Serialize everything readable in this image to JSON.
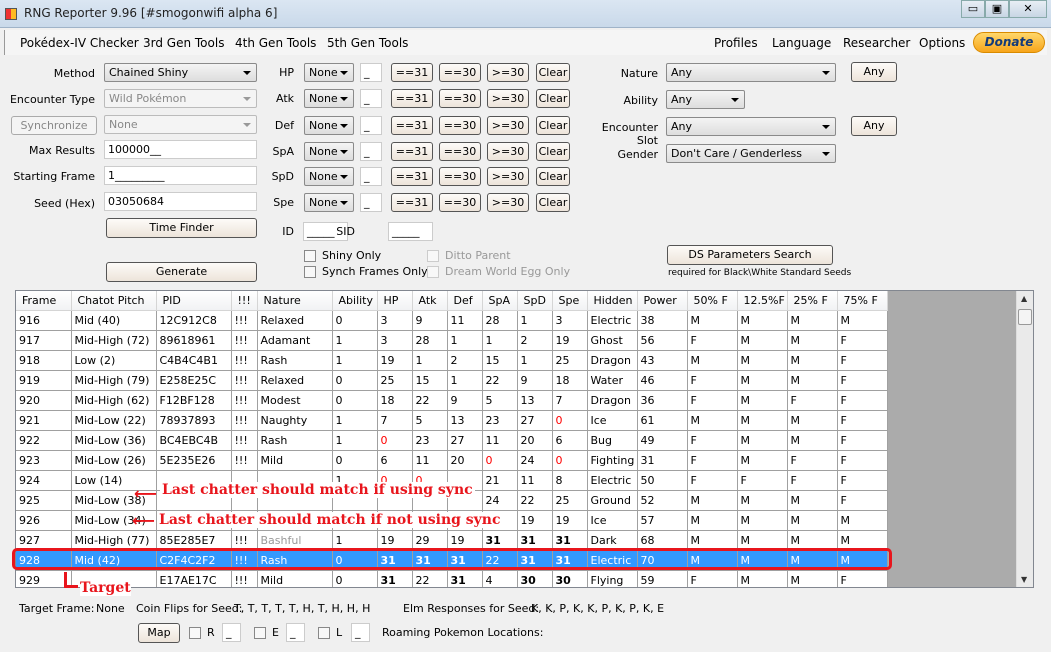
{
  "window": {
    "title": "RNG Reporter 9.96 [#smogonwifi alpha 6]",
    "controls": [
      "minimize",
      "maximize",
      "close"
    ]
  },
  "menu": {
    "left": [
      "Pokédex-IV Checker",
      "3rd Gen Tools",
      "4th Gen Tools",
      "5th Gen Tools"
    ],
    "right": [
      "Profiles",
      "Language",
      "Researcher",
      "Options"
    ],
    "donate": "Donate"
  },
  "form": {
    "method_label": "Method",
    "method": "Chained Shiny",
    "encounter_label": "Encounter Type",
    "encounter": "Wild Pokémon",
    "synchronize": "Synchronize",
    "sync_value": "None",
    "max_results_label": "Max Results",
    "max_results": "100000__",
    "starting_frame_label": "Starting Frame",
    "starting_frame": "1_________",
    "seed_label": "Seed (Hex)",
    "seed": "03050684",
    "time_finder": "Time Finder",
    "generate": "Generate",
    "ivs": [
      {
        "stat": "HP",
        "filter": "None",
        "value": "_"
      },
      {
        "stat": "Atk",
        "filter": "None",
        "value": "_"
      },
      {
        "stat": "Def",
        "filter": "None",
        "value": "_"
      },
      {
        "stat": "SpA",
        "filter": "None",
        "value": "_"
      },
      {
        "stat": "SpD",
        "filter": "None",
        "value": "_"
      },
      {
        "stat": "Spe",
        "filter": "None",
        "value": "_"
      }
    ],
    "iv_buttons": [
      "==31",
      "==30",
      ">=30",
      "Clear"
    ],
    "id_label": "ID",
    "id": "_____",
    "sid_label": "SID",
    "sid": "_____",
    "shiny_only": "Shiny Only",
    "synch_frames_only": "Synch Frames Only",
    "ditto_parent": "Ditto Parent",
    "dream_world": "Dream World Egg Only",
    "nature_label": "Nature",
    "nature": "Any",
    "ability_label": "Ability",
    "ability": "Any",
    "slot_label": "Encounter Slot",
    "slot": "Any",
    "gender_label": "Gender",
    "gender": "Don't Care / Genderless",
    "any_button": "Any",
    "ds_params": "DS Parameters Search",
    "ds_note": "required for Black\\White Standard Seeds"
  },
  "table": {
    "columns": [
      "Frame",
      "Chatot Pitch",
      "PID",
      "!!!",
      "Nature",
      "Ability",
      "HP",
      "Atk",
      "Def",
      "SpA",
      "SpD",
      "Spe",
      "Hidden",
      "Power",
      "50% F",
      "12.5%F",
      "25% F",
      "75% F"
    ],
    "neutral_natures": [
      "Bashful"
    ],
    "selected_frame": "928",
    "rows": [
      [
        "916",
        "Mid (40)",
        "12C912C8",
        "!!!",
        "Relaxed",
        "0",
        "3",
        "9",
        "11",
        "28",
        "1",
        "3",
        "Electric",
        "38",
        "M",
        "M",
        "M",
        "M"
      ],
      [
        "917",
        "Mid-High (72)",
        "89618961",
        "!!!",
        "Adamant",
        "1",
        "3",
        "28",
        "1",
        "1",
        "2",
        "19",
        "Ghost",
        "56",
        "F",
        "M",
        "M",
        "F"
      ],
      [
        "918",
        "Low (2)",
        "C4B4C4B1",
        "!!!",
        "Rash",
        "1",
        "19",
        "1",
        "2",
        "15",
        "1",
        "25",
        "Dragon",
        "43",
        "M",
        "M",
        "M",
        "F"
      ],
      [
        "919",
        "Mid-High (79)",
        "E258E25C",
        "!!!",
        "Relaxed",
        "0",
        "25",
        "15",
        "1",
        "22",
        "9",
        "18",
        "Water",
        "46",
        "F",
        "M",
        "M",
        "F"
      ],
      [
        "920",
        "Mid-High (62)",
        "F12BF128",
        "!!!",
        "Modest",
        "0",
        "18",
        "22",
        "9",
        "5",
        "13",
        "7",
        "Dragon",
        "36",
        "F",
        "M",
        "F",
        "F"
      ],
      [
        "921",
        "Mid-Low (22)",
        "78937893",
        "!!!",
        "Naughty",
        "1",
        "7",
        "5",
        "13",
        "23",
        "27",
        "0",
        "Ice",
        "61",
        "M",
        "M",
        "M",
        "F"
      ],
      [
        "922",
        "Mid-Low (36)",
        "BC4EBC4B",
        "!!!",
        "Rash",
        "1",
        "0",
        "23",
        "27",
        "11",
        "20",
        "6",
        "Bug",
        "49",
        "F",
        "M",
        "M",
        "F"
      ],
      [
        "923",
        "Mid-Low (26)",
        "5E235E26",
        "!!!",
        "Mild",
        "0",
        "6",
        "11",
        "20",
        "0",
        "24",
        "0",
        "Fighting",
        "31",
        "F",
        "M",
        "F",
        "F"
      ],
      [
        "924",
        "Low (14)",
        "",
        "",
        "",
        "1",
        "0",
        "0",
        "",
        "21",
        "11",
        "8",
        "Electric",
        "50",
        "F",
        "F",
        "F",
        "F"
      ],
      [
        "925",
        "Mid-Low (38)",
        "",
        "",
        "",
        "",
        "",
        "",
        "",
        "24",
        "22",
        "25",
        "Ground",
        "52",
        "M",
        "M",
        "M",
        "F"
      ],
      [
        "926",
        "Mid-Low (34)",
        "",
        "",
        "",
        "",
        "",
        "",
        "",
        "29",
        "19",
        "19",
        "Ice",
        "57",
        "M",
        "M",
        "M",
        "M"
      ],
      [
        "927",
        "Mid-High (77)",
        "85E285E7",
        "!!!",
        "Bashful",
        "1",
        "19",
        "29",
        "19",
        "31",
        "31",
        "31",
        "Dark",
        "68",
        "M",
        "M",
        "M",
        "M"
      ],
      [
        "928",
        "Mid (42)",
        "C2F4C2F2",
        "!!!",
        "Rash",
        "0",
        "31",
        "31",
        "31",
        "22",
        "31",
        "31",
        "Electric",
        "70",
        "M",
        "M",
        "M",
        "M"
      ],
      [
        "929",
        "",
        "E17AE17C",
        "!!!",
        "Mild",
        "0",
        "31",
        "22",
        "31",
        "4",
        "30",
        "30",
        "Flying",
        "59",
        "F",
        "M",
        "M",
        "F"
      ]
    ]
  },
  "annotations": {
    "sync": "Last chatter should match if using sync",
    "nosync": "Last chatter should match if not using sync",
    "target": "Target"
  },
  "footer": {
    "target_label": "Target Frame:",
    "target": "None",
    "coin_label": "Coin Flips for Seed:",
    "coin": "T, T, T, T, T, H, T, H, H, H",
    "elm_label": "Elm Responses for Seed:",
    "elm": "K, K, P, K, K, P, K, P, K, E",
    "map": "Map",
    "r": "R",
    "e": "E",
    "l": "L",
    "r_val": "_",
    "e_val": "_",
    "l_val": "_",
    "roaming": "Roaming Pokemon Locations:"
  },
  "colors": {
    "selection": "#3399ff",
    "annotation": "#e8151c",
    "donate": "#f7a51c"
  }
}
